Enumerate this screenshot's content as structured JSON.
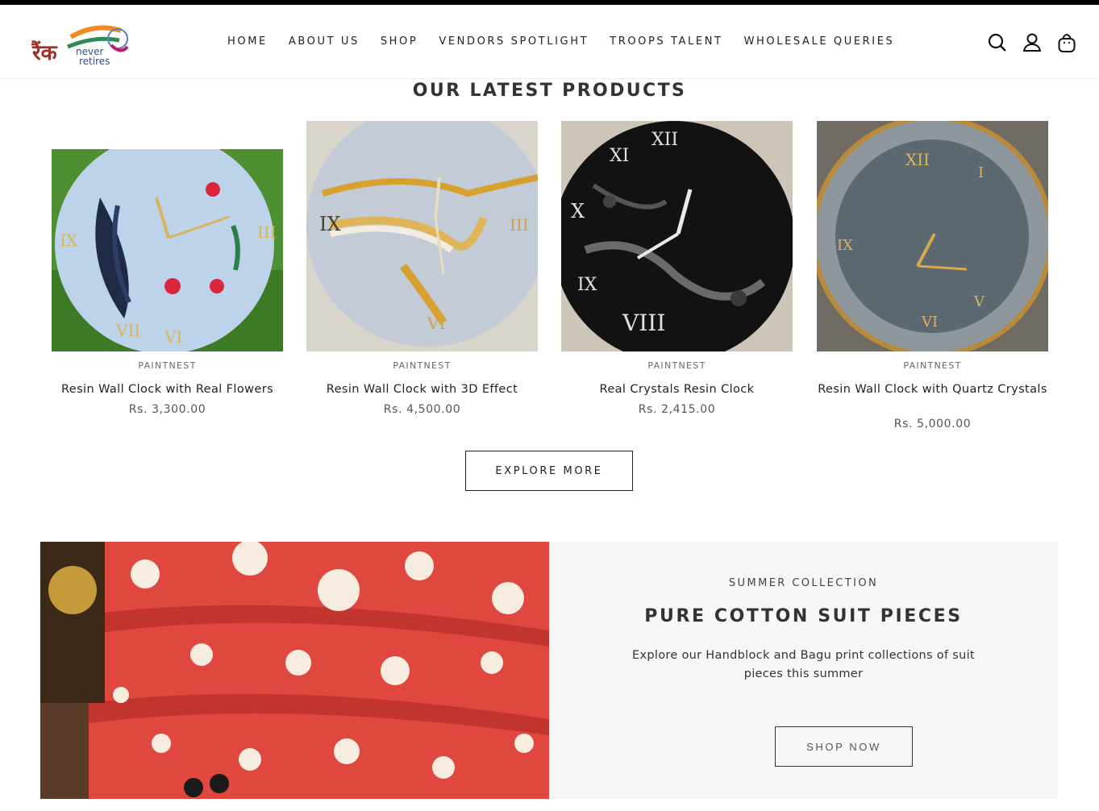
{
  "brand": {
    "logo_hindi": "रैंक",
    "logo_line1": "never",
    "logo_line2": "retires"
  },
  "nav": [
    {
      "label": "HOME"
    },
    {
      "label": "ABOUT US"
    },
    {
      "label": "SHOP"
    },
    {
      "label": "VENDORS SPOTLIGHT"
    },
    {
      "label": "TROOPS TALENT"
    },
    {
      "label": "WHOLESALE QUERIES"
    }
  ],
  "header_icons": [
    "search-icon",
    "account-icon",
    "cart-icon"
  ],
  "latest": {
    "title": "OUR LATEST PRODUCTS",
    "products": [
      {
        "vendor": "PAINTNEST",
        "name": "Resin Wall Clock with Real Flowers",
        "price": "Rs. 3,300.00",
        "image": "resin-clock-flowers"
      },
      {
        "vendor": "PAINTNEST",
        "name": "Resin Wall Clock with 3D Effect",
        "price": "Rs. 4,500.00",
        "image": "resin-clock-3d"
      },
      {
        "vendor": "PAINTNEST",
        "name": "Real Crystals Resin Clock",
        "price": "Rs. 2,415.00",
        "image": "resin-clock-crystals"
      },
      {
        "vendor": "PAINTNEST",
        "name": "Resin Wall Clock with Quartz Crystals",
        "price": "Rs. 5,000.00",
        "image": "resin-clock-quartz"
      }
    ],
    "explore_label": "EXPLORE MORE"
  },
  "banner": {
    "subtitle": "SUMMER COLLECTION",
    "title": "PURE COTTON SUIT PIECES",
    "description": "Explore our Handblock and Bagu print collections of suit pieces this summer",
    "button_label": "SHOP NOW",
    "image": "red-floral-cotton-fabric"
  },
  "colors": {
    "accent": "#000000",
    "banner_bg": "#f7f7f7",
    "fabric_red": "#e0473e"
  }
}
